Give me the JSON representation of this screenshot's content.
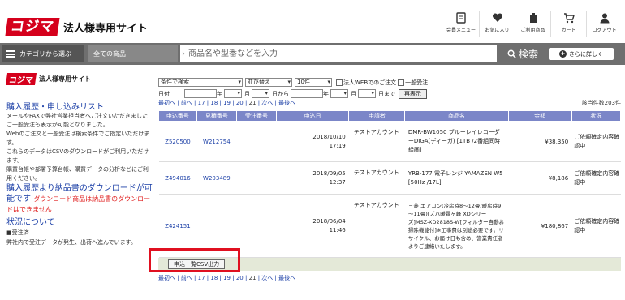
{
  "header": {
    "logo": "コジマ",
    "site_title": "法人様専用サイト",
    "icons": [
      {
        "name": "menu-icon",
        "label": "会員メニュー"
      },
      {
        "name": "heart-icon",
        "label": "お気に入り"
      },
      {
        "name": "ordered-products-icon",
        "label": "ご利用商品"
      },
      {
        "name": "cart-icon",
        "label": "カート"
      },
      {
        "name": "logout-icon",
        "label": "ログアウト"
      }
    ]
  },
  "search": {
    "category_button": "カテゴリから選ぶ",
    "all_products": "全ての商品",
    "placeholder": "商品名や型番などを入力",
    "search_button": "検索",
    "detail_button": "さらに詳しく"
  },
  "sidebar": {
    "logo": "コジマ",
    "logo_sub": "法人様専用サイト",
    "title1": "購入履歴・申し込みリスト",
    "text1": "メールやFAXで弊社営業担当者へご注文いただきましたご一般受注も表示が可能となりました。",
    "text2": "Webのご注文と一般受注は検索条件でご指定いただけます。",
    "text3": "これらのデータはCSVのダウンロードがご利用いただけます。",
    "text4": "購買台帳や部署予算台帳、購買データの分析などにご利用ください。",
    "title2": "購入履歴より納品書のダウンロードが可能です",
    "red_note": "ダウンロード商品は納品書のダウンロードはできません",
    "title3": "状況について",
    "bullet": "■受注済",
    "bullet_text": "弊社内で受注データが発生、出荷へ進んでいます。"
  },
  "filters": {
    "search_condition": "条件で検索",
    "sort": "並び替え",
    "per_page": "10件",
    "web_only": "法人WEBでのご注文",
    "general": "一般受注",
    "date_label": "日付",
    "year": "年",
    "month": "月",
    "day": "日",
    "from": "日から",
    "to": "日まで",
    "redisplay": "再表示"
  },
  "pager": {
    "first": "最初へ",
    "prev": "前へ",
    "pages": [
      "17",
      "18",
      "19",
      "20",
      "21"
    ],
    "current": "21",
    "next": "次へ",
    "last": "最後へ",
    "count": "該当件数203件"
  },
  "table": {
    "headers": [
      "申込番号",
      "見積番号",
      "受注番号",
      "申込日",
      "申請者",
      "商品名",
      "金額",
      "状況"
    ],
    "rows": [
      {
        "app_no": "Z520500",
        "quote_no": "W212754",
        "order_no": "",
        "date": "2018/10/10",
        "time": "17:19",
        "applicant": "テストアカウント",
        "product": "DMR-BW1050 ブルーレイレコーダーDIGA(ディーガ) [1TB /2番組同時録画]",
        "amount": "¥38,350",
        "status": "ご依頼確定内容確認中"
      },
      {
        "app_no": "Z494016",
        "quote_no": "W203489",
        "order_no": "",
        "date": "2018/09/05",
        "time": "12:37",
        "applicant": "テストアカウント",
        "product": "YRB-177 電子レンジ YAMAZEN W5 [50Hz /17L]",
        "amount": "¥8,186",
        "status": "ご依頼確定内容確認中"
      },
      {
        "app_no": "Z424151",
        "quote_no": "",
        "order_no": "",
        "date": "2018/06/04",
        "time": "11:46",
        "applicant": "テストアカウント",
        "product": "三菱 エアコン(冷房時8～12畳/暖房時9～11畳)[ズバ暖霧ヶ峰 XDシリーズ]MSZ-XD2818S-W[フィルター自動お掃除機能付]※工事費は別途必要です。リサイクル、お届け日も含め、営業責任者よりご連絡いたします。",
        "amount": "¥180,867",
        "status": "ご依頼確定内容確認中"
      }
    ]
  },
  "csv_button": "申込一覧CSV出力",
  "colors": {
    "brand": "#d5001c",
    "table_header": "#7b86c8",
    "link": "#1a3ea6",
    "highlight": "#e01020"
  }
}
